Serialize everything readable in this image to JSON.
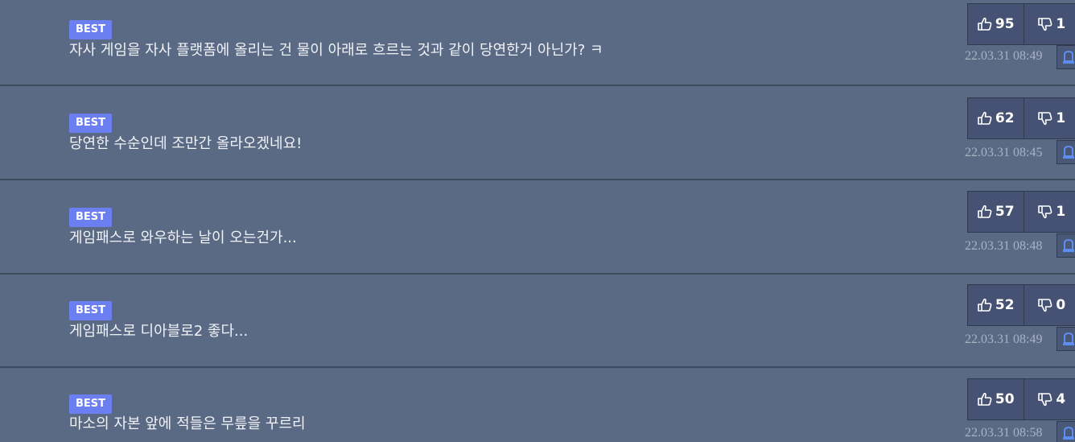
{
  "colors": {
    "background": "#5a6a85",
    "best_badge": "#6c7ff0",
    "vote_box": "#465273",
    "report_icon": "#5b8ef0",
    "timestamp_text": "#a9b2c2",
    "comment_text": "#f0f2f6"
  },
  "icons": {
    "upvote": "thumbs-up-icon",
    "downvote": "thumbs-down-icon",
    "report": "bell-icon"
  },
  "comments": [
    {
      "badge": "BEST",
      "text": "자사 게임을 자사 플랫폼에 올리는 건 물이 아래로 흐르는 것과 같이 당연한거 아닌가? ㅋ",
      "upvotes": "95",
      "downvotes": "1",
      "timestamp": "22.03.31 08:49"
    },
    {
      "badge": "BEST",
      "text": "당연한 수순인데 조만간 올라오겠네요!",
      "upvotes": "62",
      "downvotes": "1",
      "timestamp": "22.03.31 08:45"
    },
    {
      "badge": "BEST",
      "text": "게임패스로 와우하는 날이 오는건가...",
      "upvotes": "57",
      "downvotes": "1",
      "timestamp": "22.03.31 08:48"
    },
    {
      "badge": "BEST",
      "text": "게임패스로 디아블로2 좋다...",
      "upvotes": "52",
      "downvotes": "0",
      "timestamp": "22.03.31 08:49"
    },
    {
      "badge": "BEST",
      "text": "마소의 자본 앞에 적들은 무릎을 꾸르리",
      "upvotes": "50",
      "downvotes": "4",
      "timestamp": "22.03.31 08:58"
    }
  ]
}
